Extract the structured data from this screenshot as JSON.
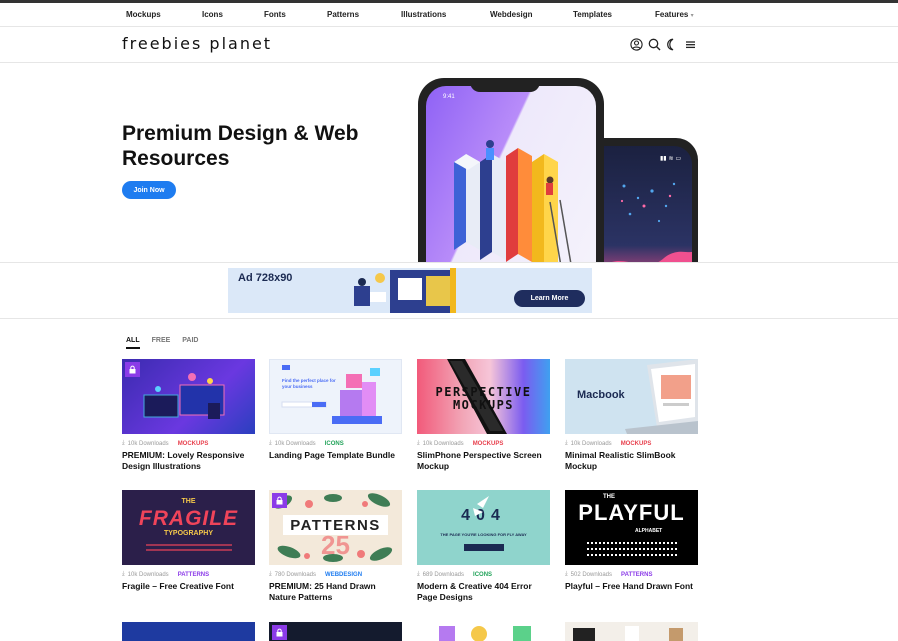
{
  "nav": {
    "items": [
      "Mockups",
      "Icons",
      "Fonts",
      "Patterns",
      "Illustrations",
      "Webdesign",
      "Templates",
      "Features"
    ]
  },
  "header": {
    "logo": "freebies planet"
  },
  "hero": {
    "title": "Premium Design & Web Resources",
    "button": "Join Now",
    "phone_time": "9:41"
  },
  "ad": {
    "label": "Ad 728x90",
    "button": "Learn More"
  },
  "tabs": [
    "ALL",
    "FREE",
    "PAID"
  ],
  "colors": {
    "accent": "#1e7cf0",
    "mockups": "#e8424f",
    "icons": "#22a35a",
    "webdesign": "#1e7cf0",
    "patterns": "#8b3be8",
    "premium_lock": "#8b3be8"
  },
  "cards": [
    {
      "downloads": "10k Downloads",
      "category": "MOCKUPS",
      "cat_color": "#e8424f",
      "title": "PREMIUM: Lovely Responsive Design Illustrations",
      "premium": true
    },
    {
      "downloads": "10k Downloads",
      "category": "ICONS",
      "cat_color": "#22a35a",
      "title": "Landing Page Template Bundle",
      "premium": false,
      "thumb_text": "Find the perfect place for your business"
    },
    {
      "downloads": "10k Downloads",
      "category": "MOCKUPS",
      "cat_color": "#e8424f",
      "title": "SlimPhone Perspective Screen Mockup",
      "premium": false,
      "thumb_text": "PERSPECTIVE MOCKUPS"
    },
    {
      "downloads": "10k Downloads",
      "category": "MOCKUPS",
      "cat_color": "#e8424f",
      "title": "Minimal Realistic SlimBook Mockup",
      "premium": false,
      "thumb_text": "Macbook"
    },
    {
      "downloads": "10k Downloads",
      "category": "PATTERNS",
      "cat_color": "#8b3be8",
      "title": "Fragile – Free Creative Font",
      "premium": false,
      "thumb_text": "FRAGILE",
      "thumb_text2": "THE",
      "thumb_text3": "TYPOGRAPHY"
    },
    {
      "downloads": "780 Downloads",
      "category": "WEBDESIGN",
      "cat_color": "#1e7cf0",
      "title": "PREMIUM: 25 Hand Drawn Nature Patterns",
      "premium": true,
      "thumb_text": "PATTERNS",
      "thumb_text2": "25"
    },
    {
      "downloads": "689 Downloads",
      "category": "ICONS",
      "cat_color": "#22a35a",
      "title": "Modern & Creative 404 Error Page Designs",
      "premium": false,
      "thumb_text": "404",
      "thumb_text2": "THE PAGE YOU'RE LOOKING FOR FLY AWAY"
    },
    {
      "downloads": "502 Downloads",
      "category": "PATTERNS",
      "cat_color": "#8b3be8",
      "title": "Playful – Free Hand Drawn Font",
      "premium": false,
      "thumb_text": "PLAYFUL",
      "thumb_text2": "THE",
      "thumb_text3": "ALPHABET"
    }
  ]
}
